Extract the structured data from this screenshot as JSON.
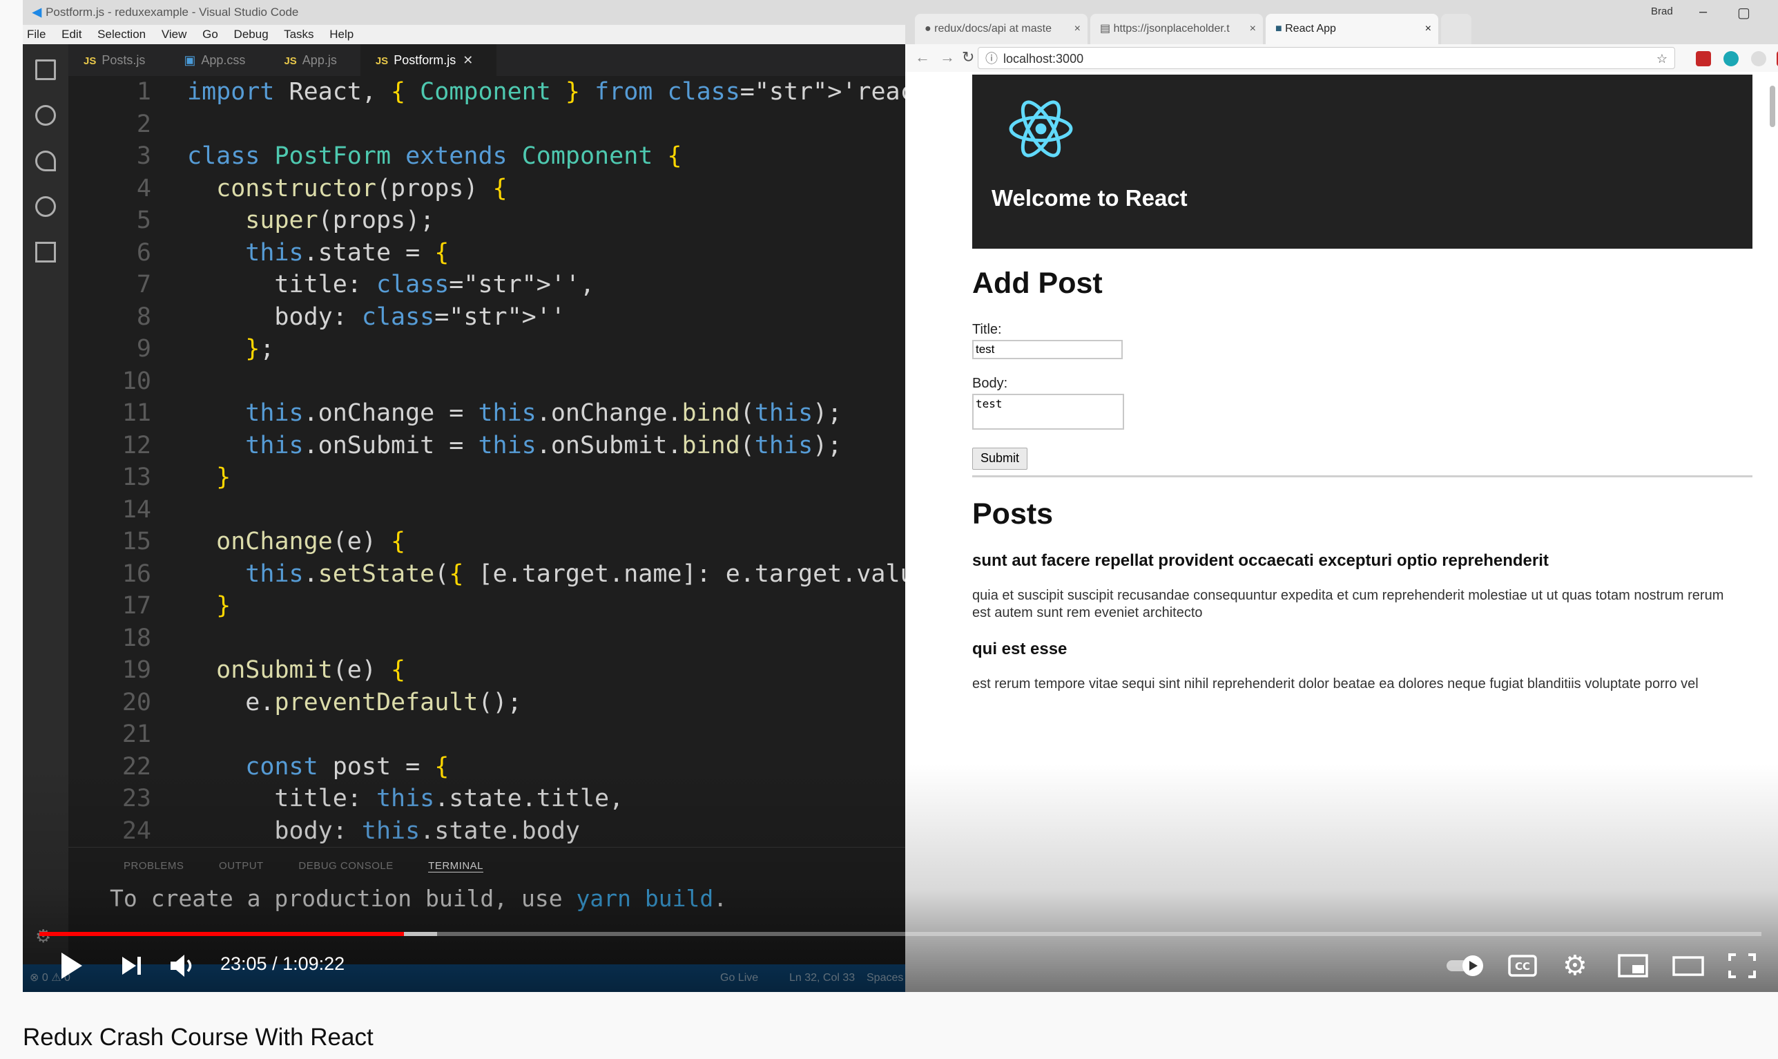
{
  "vscode": {
    "title": "Postform.js - reduxexample - Visual Studio Code",
    "menu": [
      "File",
      "Edit",
      "Selection",
      "View",
      "Go",
      "Debug",
      "Tasks",
      "Help"
    ],
    "tabs": [
      {
        "label": "Posts.js",
        "type": "js"
      },
      {
        "label": "App.css",
        "type": "css"
      },
      {
        "label": "App.js",
        "type": "js"
      },
      {
        "label": "Postform.js",
        "type": "js",
        "active": true
      }
    ],
    "tab_close": "✕",
    "code_lines": [
      "import React, { Component } from 'react';",
      "",
      "class PostForm extends Component {",
      "  constructor(props) {",
      "    super(props);",
      "    this.state = {",
      "      title: '',",
      "      body: ''",
      "    };",
      "",
      "    this.onChange = this.onChange.bind(this);",
      "    this.onSubmit = this.onSubmit.bind(this);",
      "  }",
      "",
      "  onChange(e) {",
      "    this.setState({ [e.target.name]: e.target.value });",
      "  }",
      "",
      "  onSubmit(e) {",
      "    e.preventDefault();",
      "",
      "    const post = {",
      "      title: this.state.title,",
      "      body: this.state.body"
    ],
    "panel_tabs": [
      "PROBLEMS",
      "OUTPUT",
      "DEBUG CONSOLE",
      "TERMINAL"
    ],
    "terminal_text": "To create a production build, use",
    "terminal_cmd": "yarn build",
    "terminal_end": ".",
    "status_left": "⊗ 0 ⚠ 0",
    "status_golive": "Go Live",
    "status_pos": "Ln 32, Col 33",
    "status_spaces": "Spaces"
  },
  "browser": {
    "tabs": [
      {
        "label": "redux/docs/api at maste",
        "active": false
      },
      {
        "label": "https://jsonplaceholder.t",
        "active": false
      },
      {
        "label": "React App",
        "active": true
      }
    ],
    "tab_close": "×",
    "user": "Brad",
    "url": "localhost:3000",
    "hero_title": "Welcome to React",
    "form_heading": "Add Post",
    "title_label": "Title:",
    "title_value": "test",
    "body_label": "Body:",
    "body_value": "test",
    "submit_label": "Submit",
    "posts_heading": "Posts",
    "posts": [
      {
        "title": "sunt aut facere repellat provident occaecati excepturi optio reprehenderit",
        "body": "quia et suscipit suscipit recusandae consequuntur expedita et cum reprehenderit molestiae ut ut quas totam nostrum rerum est autem sunt rem eveniet architecto"
      },
      {
        "title": "qui est esse",
        "body": "est rerum tempore vitae sequi sint nihil reprehenderit dolor beatae ea dolores neque fugiat blanditiis voluptate porro vel"
      }
    ]
  },
  "player": {
    "time": "23:05 / 1:09:22",
    "progress": 0.2117,
    "buffered": 0.2311,
    "icons": [
      "play-icon",
      "next-icon",
      "volume-icon",
      "autoplay-toggle-icon",
      "captions-icon",
      "settings-icon",
      "miniplayer-icon",
      "theater-icon",
      "fullscreen-icon"
    ],
    "accent": "#ff0000"
  },
  "video_title": "Redux Crash Course With React"
}
